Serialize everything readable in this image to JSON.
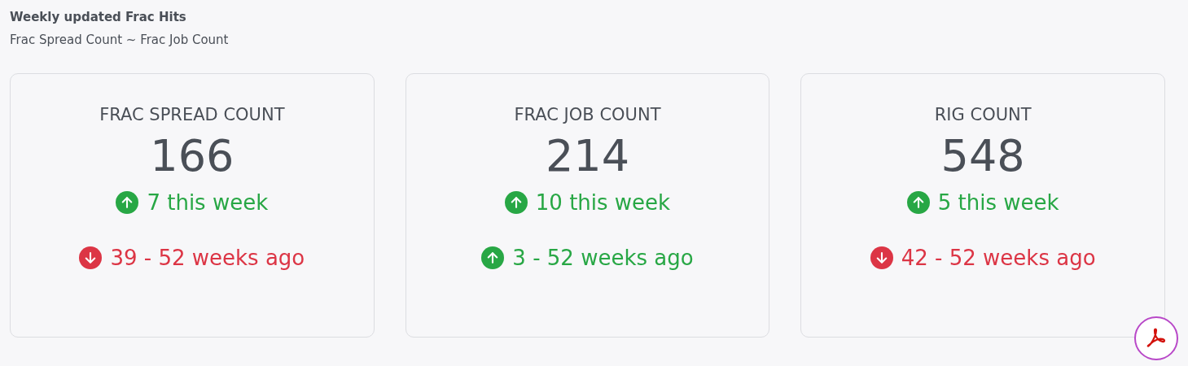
{
  "header": {
    "title": "Weekly updated Frac Hits",
    "subtitle": "Frac Spread Count ~ Frac Job Count"
  },
  "cards": [
    {
      "title": "FRAC SPREAD COUNT",
      "value": "166",
      "weekly": {
        "kind": "up",
        "text": "7 this week"
      },
      "yearly": {
        "kind": "down",
        "text": "39 - 52 weeks ago"
      }
    },
    {
      "title": "FRAC JOB COUNT",
      "value": "214",
      "weekly": {
        "kind": "up",
        "text": "10 this week"
      },
      "yearly": {
        "kind": "up",
        "text": "3 - 52 weeks ago"
      }
    },
    {
      "title": "RIG COUNT",
      "value": "548",
      "weekly": {
        "kind": "up",
        "text": "5 this week"
      },
      "yearly": {
        "kind": "down",
        "text": "42 - 52 weeks ago"
      }
    }
  ]
}
